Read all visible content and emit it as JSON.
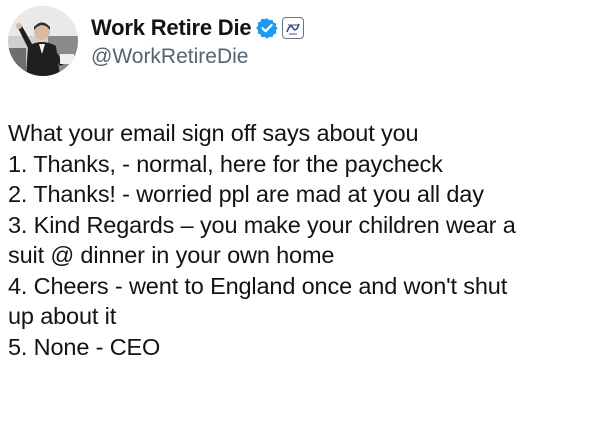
{
  "author": {
    "display_name": "Work Retire Die",
    "handle": "@WorkRetireDie",
    "verified_icon": "verified-badge-icon",
    "affiliation_icon": "affiliate-badge-icon",
    "accent_color": "#1d9bf0"
  },
  "tweet": {
    "lines": [
      "What your email sign off says about you",
      "1. Thanks, - normal, here for the paycheck",
      "2. Thanks! - worried ppl are mad at you all day",
      "3. Kind Regards – you make your children wear a",
      "suit @ dinner in your own home",
      "4. Cheers - went to England once and won't shut",
      "up about it",
      "5. None - CEO"
    ]
  }
}
